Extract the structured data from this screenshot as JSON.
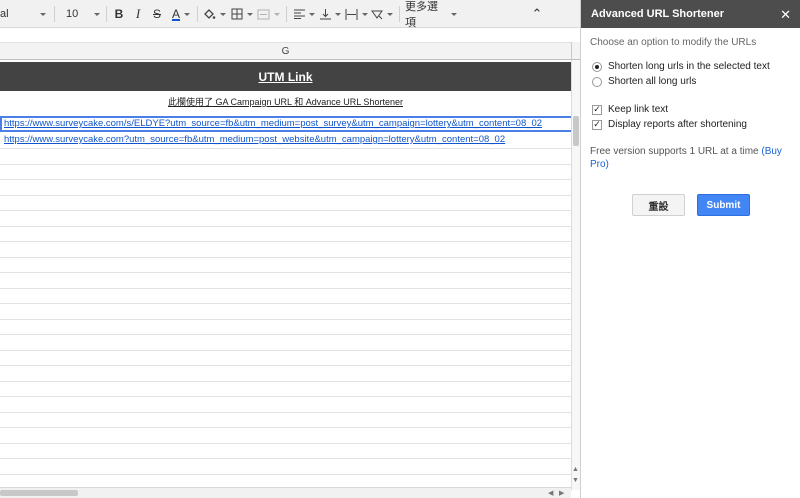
{
  "toolbar": {
    "font_name": "al",
    "font_size": "10",
    "bold": "B",
    "italic": "I",
    "strike": "S",
    "text_color": "A",
    "more_label": "更多選項",
    "collapse_glyph": "⌃"
  },
  "sheet": {
    "column_header": "G",
    "title": "UTM Link",
    "subtitle": "此欄使用了 GA Campaign URL 和 Advance URL Shortener",
    "urls": [
      "https://www.surveycake.com/s/ELDYE?utm_source=fb&utm_medium=post_survey&utm_campaign=lottery&utm_content=08_02",
      "https://www.surveycake.com?utm_source=fb&utm_medium=post_website&utm_campaign=lottery&utm_content=08_02"
    ],
    "header_color": "#434343"
  },
  "panel": {
    "title": "Advanced URL Shortener",
    "close": "✕",
    "hint": "Choose an option to modify the URLs",
    "radio_options": [
      {
        "label": "Shorten long urls in the selected text",
        "selected": true
      },
      {
        "label": "Shorten all long urls",
        "selected": false
      }
    ],
    "checkboxes": [
      {
        "label": "Keep link text",
        "checked": true
      },
      {
        "label": "Display reports after shortening",
        "checked": true
      }
    ],
    "free_text": "Free version supports 1 URL at a time",
    "buy_pro": "(Buy Pro)",
    "reset_label": "重設",
    "submit_label": "Submit",
    "accent_color": "#4285f4"
  }
}
